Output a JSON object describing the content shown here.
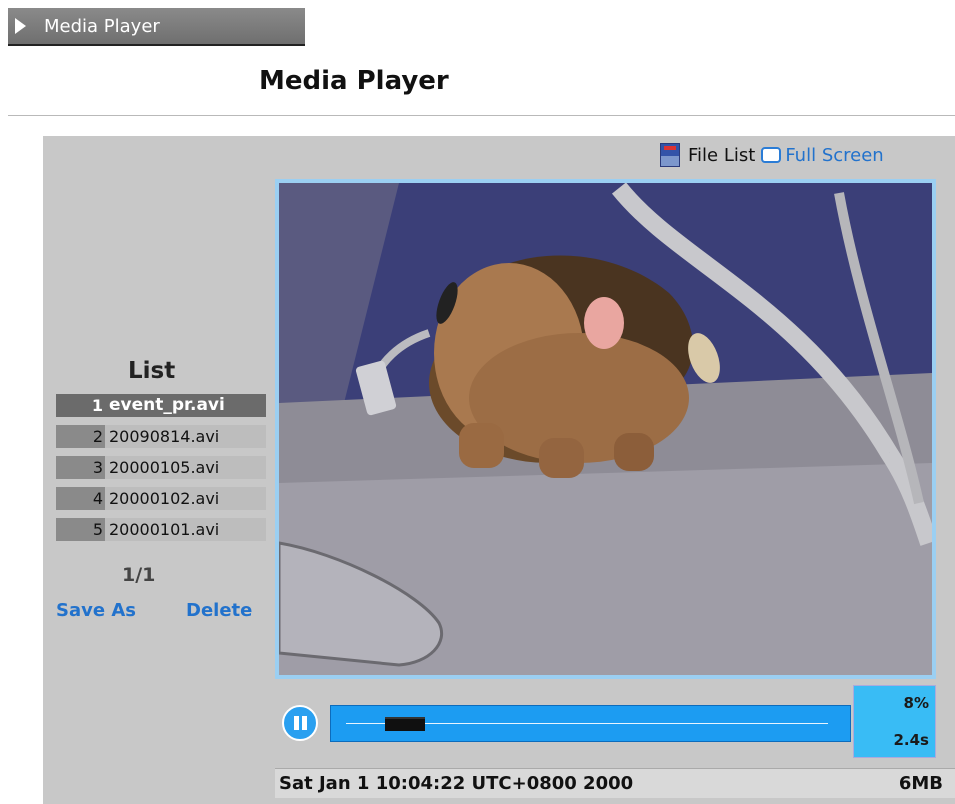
{
  "header": {
    "tab_title": "Media Player",
    "page_title": "Media Player"
  },
  "toolbar": {
    "file_list_label": "File List",
    "full_screen_label": "Full Screen",
    "file_list_icon": "sd-card-icon",
    "full_screen_icon": "full-screen-icon"
  },
  "file_list": {
    "title": "List",
    "items": [
      {
        "num": "1",
        "name": "event_pr.avi"
      },
      {
        "num": "2",
        "name": "20090814.avi"
      },
      {
        "num": "3",
        "name": "20000105.avi"
      },
      {
        "num": "4",
        "name": "20000102.avi"
      },
      {
        "num": "5",
        "name": "20000101.avi"
      }
    ],
    "pager": "1/1",
    "save_as_label": "Save As",
    "delete_label": "Delete"
  },
  "player": {
    "progress_percent_label": "8%",
    "elapsed_label": "2.4s",
    "progress_fraction": 0.08,
    "status_time": "Sat Jan 1 10:04:22 UTC+0800 2000",
    "status_size": "6MB"
  },
  "colors": {
    "accent": "#2272cc",
    "seek_bar": "#1c9cf2",
    "stat_box": "#39bcf5",
    "panel": "#c8c8c8"
  }
}
